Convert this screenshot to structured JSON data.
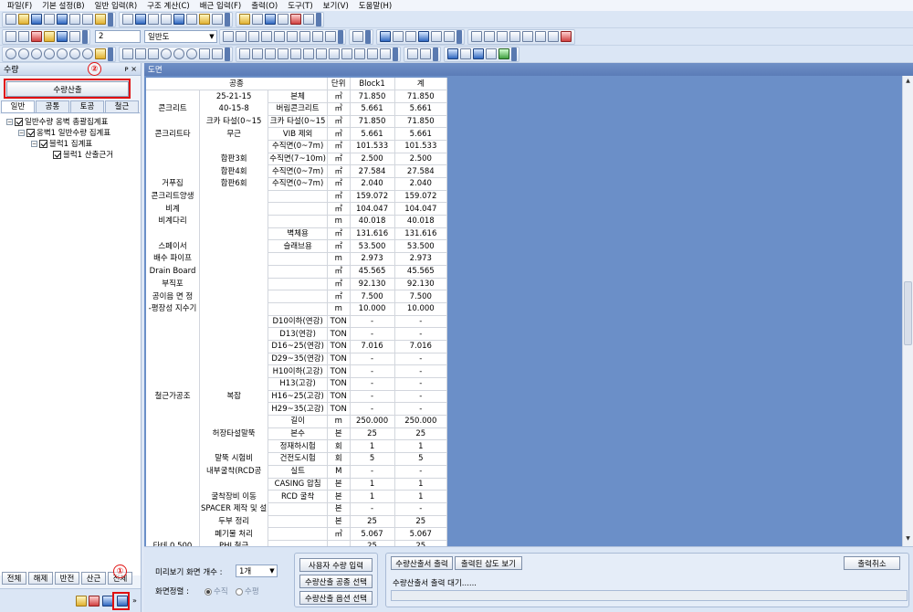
{
  "menu": [
    "파일(F)",
    "기본 설정(B)",
    "일반 입력(R)",
    "구조 계산(C)",
    "배근 입력(F)",
    "출력(O)",
    "도구(T)",
    "보기(V)",
    "도움말(H)"
  ],
  "toolbar": {
    "floor_value": "2",
    "view_mode": "일반도"
  },
  "left_panel": {
    "title": "수량",
    "pin": "ᴘ ×",
    "calc_button": "수량산출",
    "tabs": [
      "일반",
      "공통",
      "토공",
      "철근"
    ],
    "tree": [
      {
        "label": "일반수량 옹벽 총괄집계표",
        "level": 0
      },
      {
        "label": "옹벽1 일반수량 집계표",
        "level": 1
      },
      {
        "label": "블럭1 집계표",
        "level": 2
      },
      {
        "label": "블럭1 산출근거",
        "level": 3
      }
    ],
    "bottom_buttons": [
      "전체",
      "해제",
      "반전",
      "산근",
      "전체"
    ],
    "markers": [
      "②",
      "①"
    ]
  },
  "document": {
    "title": "도면",
    "headers": [
      "공종",
      "단위",
      "Block1",
      "계"
    ],
    "rows": [
      [
        "",
        "25-21-15",
        "본체",
        "㎥",
        "71.850",
        "71.850"
      ],
      [
        "콘크리트",
        "40-15-8",
        "버림콘크리트",
        "㎥",
        "5.661",
        "5.661"
      ],
      [
        "",
        "크카 타설(0~15",
        "크카 타설(0~15",
        "㎥",
        "71.850",
        "71.850"
      ],
      [
        "콘크리트타",
        "무근",
        "VIB 제외",
        "㎥",
        "5.661",
        "5.661"
      ],
      [
        "",
        "",
        "수직면(0~7m)",
        "㎡",
        "101.533",
        "101.533"
      ],
      [
        "",
        "합판3회",
        "수직면(7~10m)",
        "㎡",
        "2.500",
        "2.500"
      ],
      [
        "",
        "합판4회",
        "수직면(0~7m)",
        "㎡",
        "27.584",
        "27.584"
      ],
      [
        "거푸집",
        "합판6회",
        "수직면(0~7m)",
        "㎡",
        "2.040",
        "2.040"
      ],
      [
        "콘크리트양생",
        "",
        "",
        "㎡",
        "159.072",
        "159.072"
      ],
      [
        "비계",
        "",
        "",
        "㎡",
        "104.047",
        "104.047"
      ],
      [
        "비계다리",
        "",
        "",
        "m",
        "40.018",
        "40.018"
      ],
      [
        "",
        "",
        "벽체용",
        "㎡",
        "131.616",
        "131.616"
      ],
      [
        "스페이서",
        "",
        "슬래브용",
        "㎡",
        "53.500",
        "53.500"
      ],
      [
        "배수 파이프",
        "",
        "",
        "m",
        "2.973",
        "2.973"
      ],
      [
        "Drain Board",
        "",
        "",
        "㎡",
        "45.565",
        "45.565"
      ],
      [
        "부직포",
        "",
        "",
        "㎡",
        "92.130",
        "92.130"
      ],
      [
        "공이음 면 정",
        "",
        "",
        "㎡",
        "7.500",
        "7.500"
      ],
      [
        "-평장성 지수기",
        "",
        "",
        "m",
        "10.000",
        "10.000"
      ],
      [
        "",
        "",
        "D10이하(연강)",
        "TON",
        "-",
        "-"
      ],
      [
        "",
        "",
        "D13(연강)",
        "TON",
        "-",
        "-"
      ],
      [
        "",
        "",
        "D16~25(연강)",
        "TON",
        "7.016",
        "7.016"
      ],
      [
        "",
        "",
        "D29~35(연강)",
        "TON",
        "-",
        "-"
      ],
      [
        "",
        "",
        "H10이하(고강)",
        "TON",
        "-",
        "-"
      ],
      [
        "",
        "",
        "H13(고강)",
        "TON",
        "-",
        "-"
      ],
      [
        "철근가공조",
        "복잡",
        "H16~25(고강)",
        "TON",
        "-",
        "-"
      ],
      [
        "",
        "",
        "H29~35(고강)",
        "TON",
        "-",
        "-"
      ],
      [
        "",
        "",
        "길이",
        "m",
        "250.000",
        "250.000"
      ],
      [
        "",
        "허장타설말뚝",
        "본수",
        "본",
        "25",
        "25"
      ],
      [
        "",
        "",
        "정재하시험",
        "회",
        "1",
        "1"
      ],
      [
        "",
        "말뚝 시험비",
        "건전도시험",
        "회",
        "5",
        "5"
      ],
      [
        "",
        "내부굴착(RCD공",
        "실트",
        "M",
        "-",
        "-"
      ],
      [
        "",
        "",
        "CASING 압침",
        "본",
        "1",
        "1"
      ],
      [
        "",
        "굴착장비 이동",
        "RCD 굴착",
        "본",
        "1",
        "1"
      ],
      [
        "",
        "SPACER 제작 및 설",
        "",
        "본",
        "-",
        "-"
      ],
      [
        "",
        "두부 정리",
        "",
        "본",
        "25",
        "25"
      ],
      [
        "",
        "폐기물 처리",
        "",
        "㎥",
        "5.067",
        "5.067"
      ],
      [
        "타테 0.500",
        "PHI 철근",
        "",
        "",
        "25",
        "25"
      ]
    ]
  },
  "bottom": {
    "preview_label": "미리보기 화면 개수 :",
    "preview_value": "1개",
    "align_label": "화면정렬 :",
    "align_options": [
      "수직",
      "수평"
    ],
    "user_input_btn": "사용자 수량 입력",
    "work_select_btn": "수량산출 공종 선택",
    "option_select_btn": "수량산출 옵션 선택",
    "output_btn": "수량산출서 출력",
    "inserted_btn": "출력된 삽도 보기",
    "cancel_btn": "출력취소",
    "status_text": "수량산출서 출력 대기......",
    "progress": 0
  }
}
